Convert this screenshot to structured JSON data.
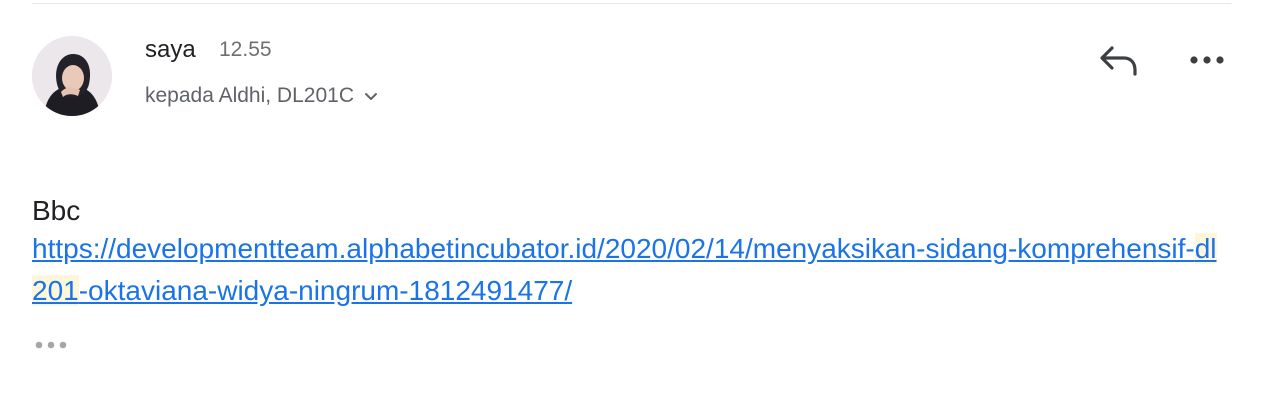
{
  "email": {
    "sender_name": "saya",
    "time": "12.55",
    "recipients": "kepada Aldhi, DL201C",
    "body_text": "Bbc",
    "link": {
      "before": "https://developmentteam.alphabetincubator.id/2020/02/14/menyaksikan-sidang-komprehensif-",
      "highlight": "dl201",
      "after": "-oktaviana-widya-ningrum-1812491477/"
    }
  },
  "icons": {
    "reply": "reply-icon",
    "more": "more-horizontal-icon",
    "expand": "chevron-down-icon",
    "trimmed": "trimmed-content-icon"
  },
  "colors": {
    "link": "#1a73e8",
    "highlight": "#fdf6d8",
    "secondary_text": "#5f6368"
  }
}
